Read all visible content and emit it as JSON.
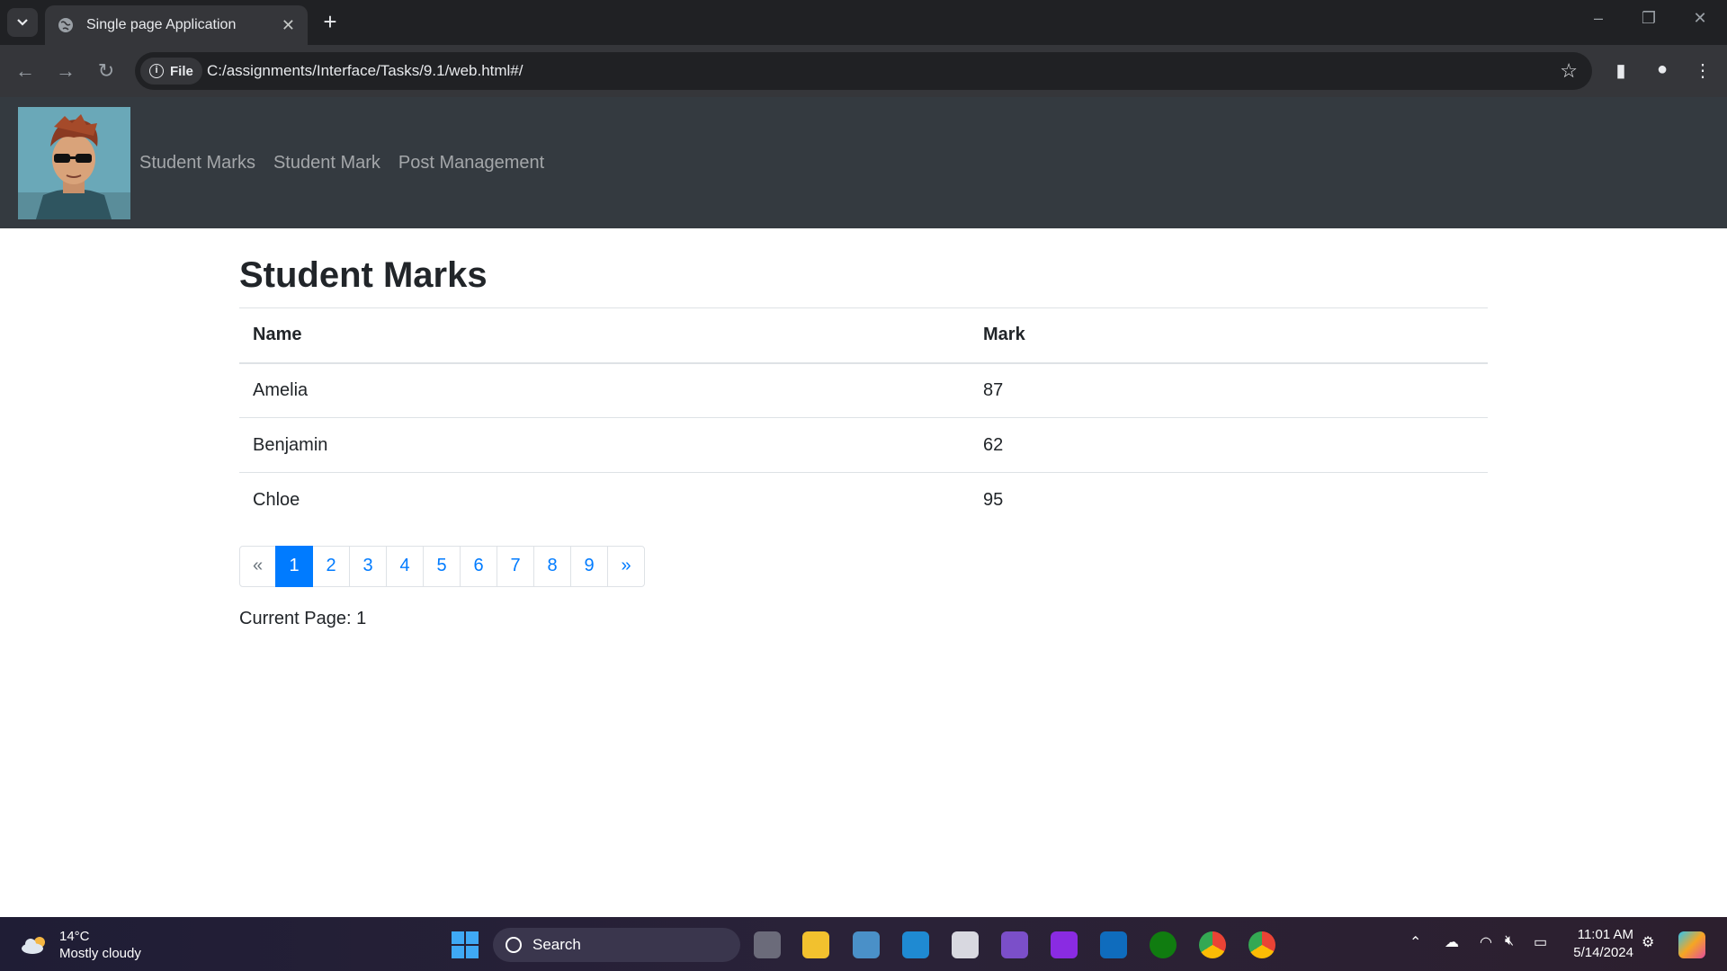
{
  "browser": {
    "tab_title": "Single page Application",
    "new_tab": "+",
    "site_chip": "File",
    "url": "C:/assignments/Interface/Tasks/9.1/web.html#/"
  },
  "navbar": {
    "links": [
      "Student Marks",
      "Student Mark",
      "Post Management"
    ]
  },
  "main": {
    "title": "Student Marks",
    "table": {
      "headers": [
        "Name",
        "Mark"
      ],
      "rows": [
        {
          "name": "Amelia",
          "mark": "87"
        },
        {
          "name": "Benjamin",
          "mark": "62"
        },
        {
          "name": "Chloe",
          "mark": "95"
        }
      ]
    },
    "pagination": {
      "prev": "«",
      "pages": [
        "1",
        "2",
        "3",
        "4",
        "5",
        "6",
        "7",
        "8",
        "9"
      ],
      "next": "»",
      "active": "1"
    },
    "current_page_text": "Current Page: 1"
  },
  "taskbar": {
    "temperature": "14°C",
    "weather": "Mostly cloudy",
    "search": "Search",
    "time": "11:01 AM",
    "date": "5/14/2024"
  },
  "colors": {
    "navbar_bg": "#343a40",
    "accent": "#007bff",
    "chrome_dark": "#202124",
    "chrome_toolbar": "#35363a"
  }
}
